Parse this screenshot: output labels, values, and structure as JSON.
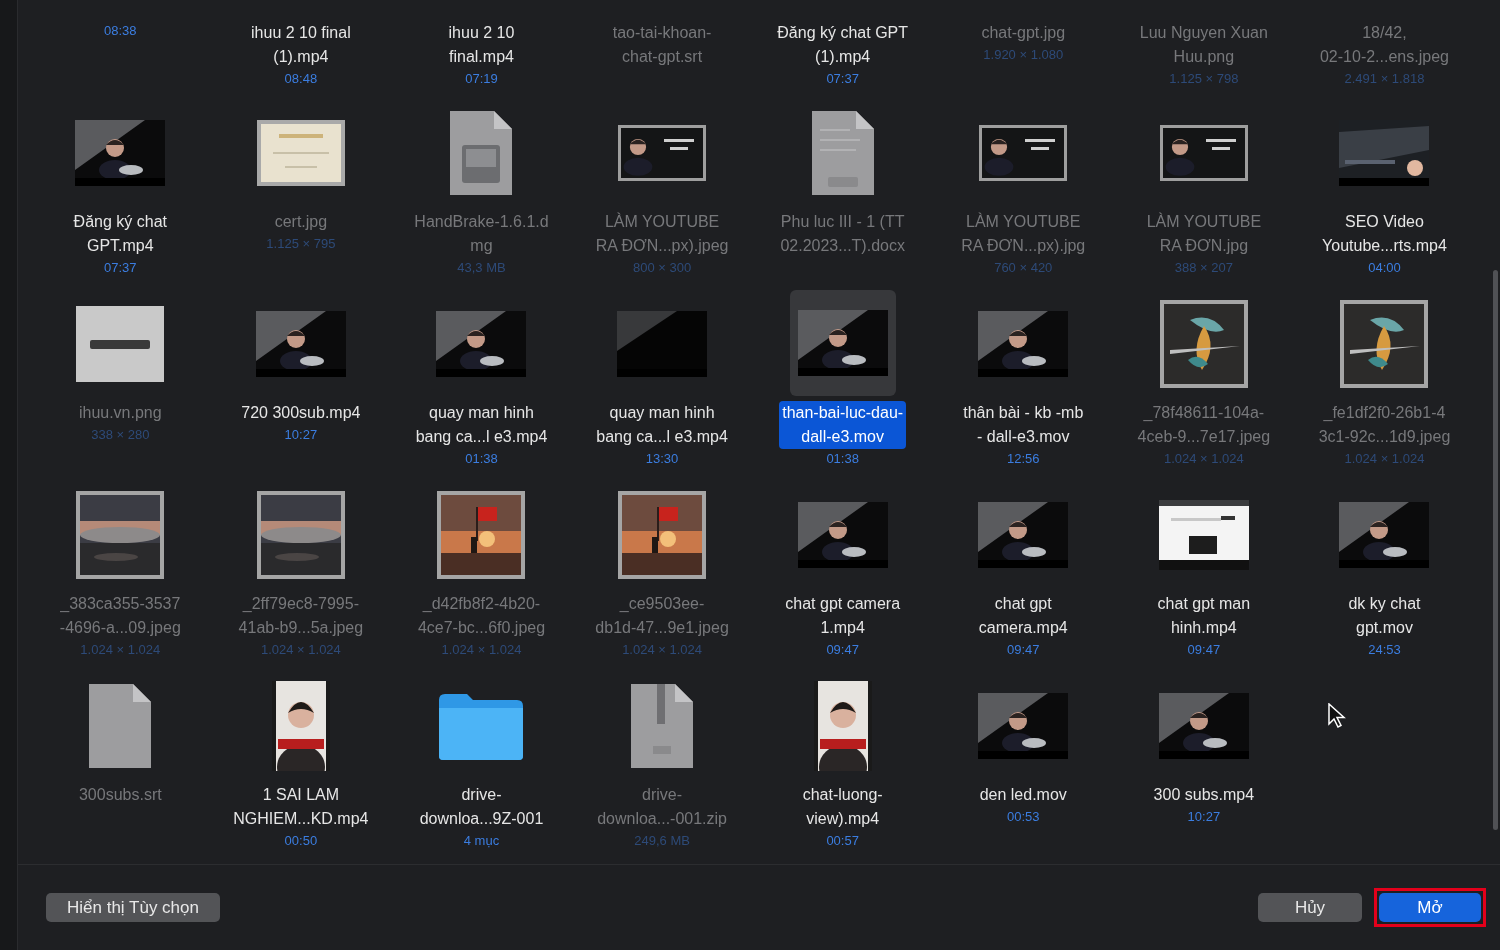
{
  "rows": [
    [
      {
        "detail": "08:38",
        "disabled": false,
        "selected": false
      },
      {
        "name": "ihuu 2 10 final\n(1).mp4",
        "detail": "08:48",
        "disabled": false,
        "selected": false
      },
      {
        "name": "ihuu 2 10\nfinal.mp4",
        "detail": "07:19",
        "disabled": false,
        "selected": false
      },
      {
        "name": "tao-tai-khoan-\nchat-gpt.srt",
        "disabled": true,
        "selected": false
      },
      {
        "name": "Đăng ký chat GPT\n(1).mp4",
        "detail": "07:37",
        "disabled": false,
        "selected": false
      },
      {
        "name": "chat-gpt.jpg",
        "detail": "1.920 × 1.080",
        "disabled": true,
        "selected": false
      },
      {
        "name": "Luu Nguyen Xuan\nHuu.png",
        "detail": "1.125 × 798",
        "disabled": true,
        "selected": false
      },
      {
        "name": "18/42,\n02-10-2...ens.jpeg",
        "detail": "2.491 × 1.818",
        "disabled": true,
        "selected": false
      }
    ],
    [
      {
        "kind": "video",
        "name": "Đăng ký chat\nGPT.mp4",
        "detail": "07:37",
        "disabled": false,
        "selected": false
      },
      {
        "kind": "cert",
        "name": "cert.jpg",
        "detail": "1.125 × 795",
        "disabled": true,
        "selected": false
      },
      {
        "kind": "dmg",
        "name": "HandBrake-1.6.1.d\nmg",
        "detail": "43,3 MB",
        "disabled": true,
        "selected": false
      },
      {
        "kind": "wide",
        "name": "LÀM YOUTUBE\nRA ĐƠN...px).jpeg",
        "detail": "800 × 300",
        "disabled": true,
        "selected": false
      },
      {
        "kind": "doc",
        "name": "Phu luc III - 1 (TT\n02.2023...T).docx",
        "disabled": true,
        "selected": false
      },
      {
        "kind": "wide",
        "name": "LÀM YOUTUBE\nRA ĐƠN...px).jpg",
        "detail": "760 × 420",
        "disabled": true,
        "selected": false
      },
      {
        "kind": "wide",
        "name": "LÀM YOUTUBE\nRA ĐƠN.jpg",
        "detail": "388 × 207",
        "disabled": true,
        "selected": false
      },
      {
        "kind": "screen",
        "name": "SEO Video\nYoutube...rts.mp4",
        "detail": "04:00",
        "disabled": false,
        "selected": false
      }
    ],
    [
      {
        "kind": "logo",
        "name": "ihuu.vn.png",
        "detail": "338 × 280",
        "disabled": true,
        "selected": false
      },
      {
        "kind": "video",
        "name": "720 300sub.mp4",
        "detail": "10:27",
        "disabled": false,
        "selected": false
      },
      {
        "kind": "video",
        "name": "quay man hinh\nbang ca...l e3.mp4",
        "detail": "01:38",
        "disabled": false,
        "selected": false
      },
      {
        "kind": "dark",
        "name": "quay man hinh\nbang ca...l e3.mp4",
        "detail": "13:30",
        "disabled": false,
        "selected": false
      },
      {
        "kind": "video",
        "name": "than-bai-luc-dau-\ndall-e3.mov",
        "detail": "01:38",
        "disabled": false,
        "selected": true
      },
      {
        "kind": "video",
        "name": "thân bài - kb -mb\n- dall-e3.mov",
        "detail": "12:56",
        "disabled": false,
        "selected": false
      },
      {
        "kind": "art",
        "name": "_78f48611-104a-\n4ceb-9...7e17.jpeg",
        "detail": "1.024 × 1.024",
        "disabled": true,
        "selected": false
      },
      {
        "kind": "art",
        "name": "_fe1df2f0-26b1-4\n3c1-92c...1d9.jpeg",
        "detail": "1.024 × 1.024",
        "disabled": true,
        "selected": false
      }
    ],
    [
      {
        "kind": "square",
        "name": "_383ca355-3537\n-4696-a...09.jpeg",
        "detail": "1.024 × 1.024",
        "disabled": true,
        "selected": false
      },
      {
        "kind": "square",
        "name": "_2ff79ec8-7995-\n41ab-b9...5a.jpeg",
        "detail": "1.024 × 1.024",
        "disabled": true,
        "selected": false
      },
      {
        "kind": "flag",
        "name": "_d42fb8f2-4b20-\n4ce7-bc...6f0.jpeg",
        "detail": "1.024 × 1.024",
        "disabled": true,
        "selected": false
      },
      {
        "kind": "flag",
        "name": "_ce9503ee-\ndb1d-47...9e1.jpeg",
        "detail": "1.024 × 1.024",
        "disabled": true,
        "selected": false
      },
      {
        "kind": "video",
        "name": "chat gpt camera\n1.mp4",
        "detail": "09:47",
        "disabled": false,
        "selected": false
      },
      {
        "kind": "video",
        "name": "chat gpt\ncamera.mp4",
        "detail": "09:47",
        "disabled": false,
        "selected": false
      },
      {
        "kind": "page",
        "name": "chat gpt man\nhinh.mp4",
        "detail": "09:47",
        "disabled": false,
        "selected": false
      },
      {
        "kind": "video",
        "name": "dk ky chat\ngpt.mov",
        "detail": "24:53",
        "disabled": false,
        "selected": false
      }
    ],
    [
      {
        "kind": "file",
        "name": "300subs.srt",
        "disabled": true,
        "selected": false
      },
      {
        "kind": "portrait",
        "name": "1 SAI LAM\nNGHIEM...KD.mp4",
        "detail": "00:50",
        "disabled": false,
        "selected": false
      },
      {
        "kind": "folder",
        "name": "drive-\ndownloa...9Z-001",
        "detail": "4 mục",
        "disabled": false,
        "selected": false
      },
      {
        "kind": "zip",
        "name": "drive-\ndownloa...-001.zip",
        "detail": "249,6 MB",
        "disabled": true,
        "selected": false
      },
      {
        "kind": "portrait",
        "name": "chat-luong-\nview).mp4",
        "detail": "00:57",
        "disabled": false,
        "selected": false
      },
      {
        "kind": "video",
        "name": "den led.mov",
        "detail": "00:53",
        "disabled": false,
        "selected": false
      },
      {
        "kind": "video",
        "name": "300 subs.mp4",
        "detail": "10:27",
        "disabled": false,
        "selected": false
      }
    ]
  ],
  "buttons": [
    {
      "label": "Hiển thị Tùy chọn",
      "kind": "plain"
    },
    {
      "label": "Hủy",
      "kind": "plain"
    },
    {
      "label": "Mở",
      "kind": "default",
      "highlighted": true
    }
  ]
}
